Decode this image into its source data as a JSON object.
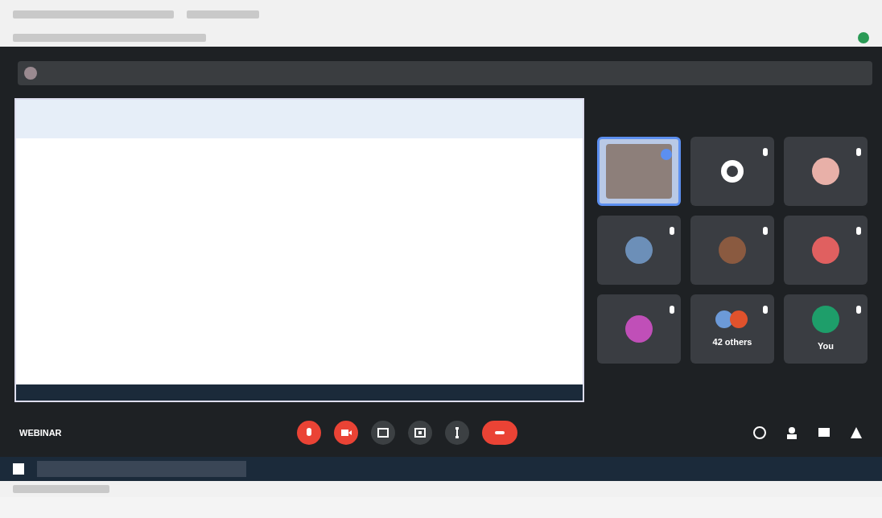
{
  "meeting": {
    "label": "WEBINAR"
  },
  "tiles": [
    {
      "kind": "video",
      "speaking": true
    },
    {
      "kind": "logo",
      "speaking": false
    },
    {
      "kind": "avatar",
      "color": "#e8b0a8",
      "speaking": false
    },
    {
      "kind": "avatar",
      "color": "#6c8fb8",
      "speaking": false
    },
    {
      "kind": "avatar",
      "color": "#8a5a40",
      "speaking": false
    },
    {
      "kind": "avatar",
      "color": "#e06060",
      "speaking": false
    },
    {
      "kind": "avatar",
      "color": "#c04fb8",
      "speaking": false
    },
    {
      "kind": "group",
      "name": "42 others",
      "speaking": false
    },
    {
      "kind": "avatar",
      "color": "#1e9e6a",
      "name": "You",
      "speaking": false
    }
  ],
  "controls": [
    {
      "kind": "mic",
      "off": true
    },
    {
      "kind": "camera",
      "off": true
    },
    {
      "kind": "captions",
      "off": false
    },
    {
      "kind": "present",
      "off": false
    },
    {
      "kind": "more",
      "off": false
    },
    {
      "kind": "leave",
      "off": true
    }
  ]
}
